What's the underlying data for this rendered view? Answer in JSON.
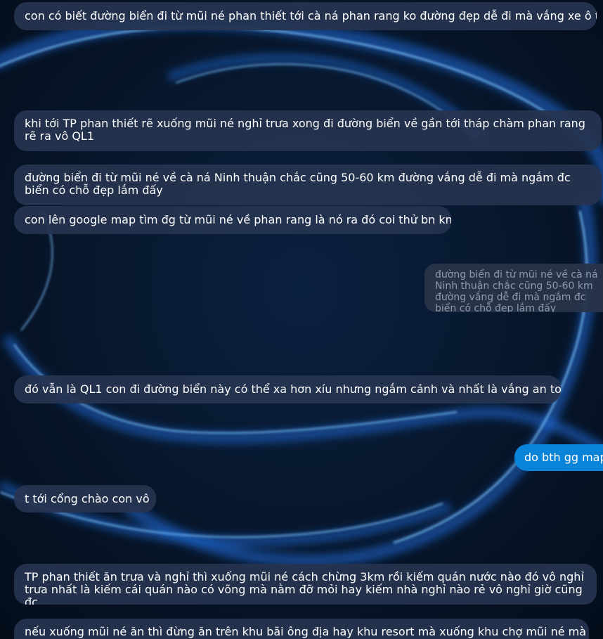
{
  "messages": [
    {
      "id": "m1",
      "side": "incoming",
      "text": "con có biết đường biển đi từ mũi né phan thiết tới cà ná phan rang ko đường đẹp dễ đi mà vắng xe ô tô"
    },
    {
      "id": "m2",
      "side": "incoming",
      "text": "khi tới TP phan thiết rẽ xuống mũi né nghỉ trưa xong đi đường biển về gần tới tháp chàm phan rang rẽ ra vô QL1"
    },
    {
      "id": "m3",
      "side": "incoming",
      "text": "đường biển đi từ mũi né về cà ná Ninh thuận chắc cũng 50-60 km đường vắng dễ đi mà ngắm đc biển có chỗ đẹp lắm đấy"
    },
    {
      "id": "m4",
      "side": "incoming",
      "text": "con lên google map tìm đg từ mũi né về phan rang là nó ra đó coi thử bn km"
    },
    {
      "id": "m5",
      "side": "outgoing-quote",
      "text": "đường biển đi từ mũi né về cà ná Ninh thuận chắc cũng 50-60 km đường vắng dễ đi mà ngắm đc biển có chỗ đẹp lắm đấy"
    },
    {
      "id": "m6",
      "side": "incoming",
      "text": "đó vẫn là QL1 con đi đường biển này có thể xa hơn xíu nhưng ngắm cảnh và nhất là vắng an toàn"
    },
    {
      "id": "m7",
      "side": "outgoing",
      "text": "do bth gg map"
    },
    {
      "id": "m8",
      "side": "incoming",
      "text": "t tới cổng chào con vô"
    },
    {
      "id": "m9",
      "side": "incoming",
      "text": "TP phan thiết ăn trưa và nghỉ thì xuống mũi né cách chừng 3km rồi kiếm quán nước nào đó vô nghỉ trưa nhất là kiếm cái quán nào có võng mà nằm đỡ mỏi hay kiếm nhà nghỉ nào rẻ vô nghỉ giờ cũng đc"
    },
    {
      "id": "m10",
      "side": "incoming",
      "text": "nếu xuống mũi né ăn thì đừng ăn trên khu bãi ông địa hay khu resort mà xuống khu chợ mũi né mà ăn"
    }
  ],
  "theme": {
    "incoming_bubble": "#263450",
    "outgoing_bubble": "#0a84d8",
    "background": "#071426",
    "glow": "#2f8cff"
  }
}
